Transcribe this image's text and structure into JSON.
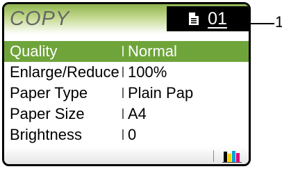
{
  "screen": {
    "title": "COPY",
    "copies": "01",
    "doc_icon": "document-icon"
  },
  "settings": [
    {
      "label": "Quality",
      "value": "Normal",
      "selected": true
    },
    {
      "label": "Enlarge/Reduce",
      "value": "100%",
      "selected": false
    },
    {
      "label": "Paper Type",
      "value": "Plain Pap",
      "selected": false
    },
    {
      "label": "Paper Size",
      "value": "A4",
      "selected": false
    },
    {
      "label": "Brightness",
      "value": "0",
      "selected": false
    }
  ],
  "status_bar": {
    "ink_icon": "ink-level-icon",
    "ink_colors": [
      "#000000",
      "#f2d200",
      "#00a0d8",
      "#e0007a"
    ]
  },
  "callout": {
    "number": "1"
  },
  "colors": {
    "accent": "#6fa43a",
    "title_gradient_start": "#8fb34e"
  }
}
